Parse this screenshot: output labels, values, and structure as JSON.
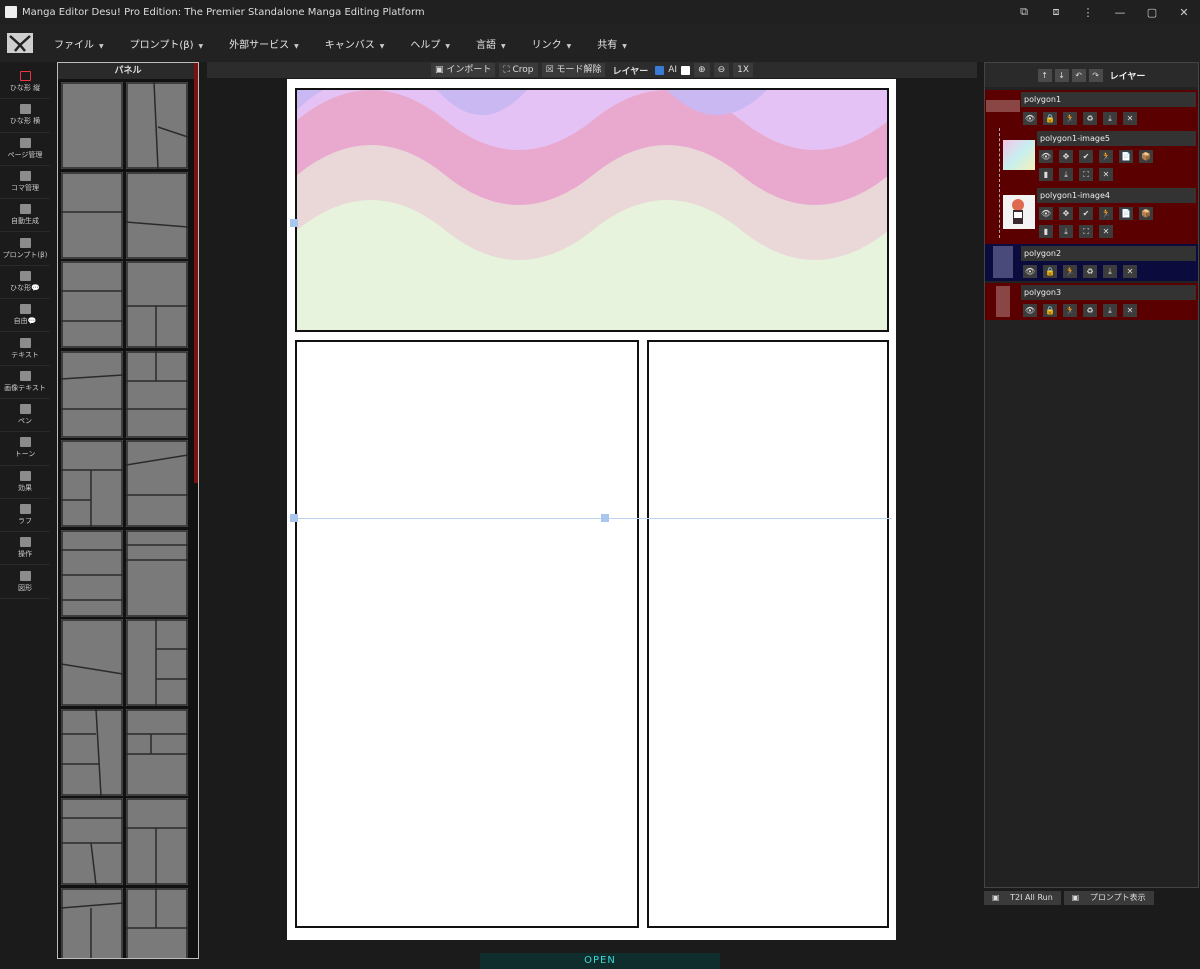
{
  "window": {
    "title": "Manga Editor Desu! Pro Edition: The Premier Standalone Manga Editing Platform",
    "controls": [
      "⧉",
      "⧈",
      "⋮",
      "—",
      "▢",
      "✕"
    ]
  },
  "menu": [
    {
      "label": "ファイル"
    },
    {
      "label": "プロンプト(β)"
    },
    {
      "label": "外部サービス"
    },
    {
      "label": "キャンバス"
    },
    {
      "label": "ヘルプ"
    },
    {
      "label": "言語"
    },
    {
      "label": "リンク"
    },
    {
      "label": "共有"
    }
  ],
  "tools": [
    {
      "label": "ひな形 縦",
      "icon": "portrait-frame-icon"
    },
    {
      "label": "ひな形 横",
      "icon": "landscape-frame-icon"
    },
    {
      "label": "ページ管理",
      "icon": "page-grid-icon"
    },
    {
      "label": "コマ管理",
      "icon": "panel-grid-icon"
    },
    {
      "label": "自動生成",
      "icon": "robot-icon"
    },
    {
      "label": "プロンプト(β)",
      "icon": "clipboard-icon"
    },
    {
      "label": "ひな形💬",
      "icon": "speech-bubble-icon"
    },
    {
      "label": "自由💬",
      "icon": "free-bubble-icon"
    },
    {
      "label": "テキスト",
      "icon": "text-icon"
    },
    {
      "label": "画像テキスト",
      "icon": "image-text-icon"
    },
    {
      "label": "ペン",
      "icon": "pen-icon"
    },
    {
      "label": "トーン",
      "icon": "tone-icon"
    },
    {
      "label": "効果",
      "icon": "effect-icon"
    },
    {
      "label": "ラフ",
      "icon": "rough-icon"
    },
    {
      "label": "操作",
      "icon": "gamepad-icon"
    },
    {
      "label": "図形",
      "icon": "shapes-icon"
    }
  ],
  "palette": {
    "title": "パネル"
  },
  "canvas_toolbar": {
    "import": "インポート",
    "crop": "Crop",
    "mode_release": "モード解除",
    "layer": "レイヤー",
    "ai": "AI",
    "ai_checked": true,
    "extra_checked": false,
    "zoom_in": "⊕",
    "zoom_out": "⊖",
    "one_x": "1X"
  },
  "open_button": "OPEN",
  "layers": {
    "title": "レイヤー",
    "header_buttons": [
      "↑",
      "↓",
      "↶",
      "↷"
    ],
    "items": [
      {
        "name": "polygon1"
      },
      {
        "name": "polygon1-image5"
      },
      {
        "name": "polygon1-image4"
      },
      {
        "name": "polygon2"
      },
      {
        "name": "polygon3"
      }
    ],
    "row_buttons": [
      "👁",
      "🔒",
      "🏃",
      "♻",
      "⤓",
      "✕"
    ],
    "image_buttons_row1": [
      "👁",
      "✥",
      "✔",
      "🏃",
      "📄",
      "📦"
    ],
    "image_buttons_row2": [
      "▮",
      "⤓",
      "⛶",
      "✕"
    ]
  },
  "bottom_buttons": {
    "t2i": "T2I All Run",
    "prompt": "プロンプト表示"
  },
  "colors": {
    "accent_red": "#5a0000",
    "accent_blue": "#0b0b3e",
    "open_text": "#3fd6d6"
  }
}
